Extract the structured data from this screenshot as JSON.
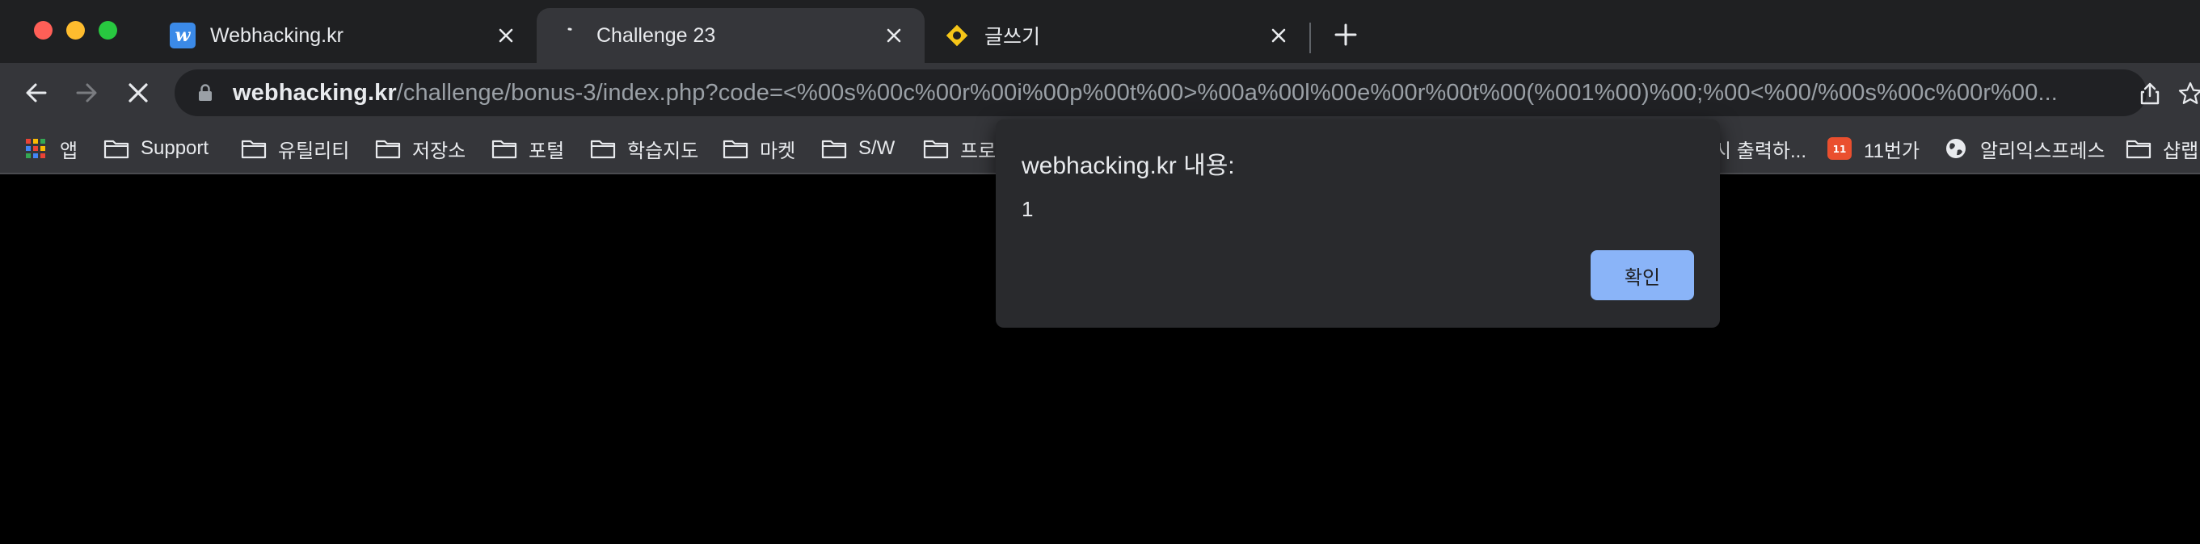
{
  "tabs": [
    {
      "title": "Webhacking.kr",
      "favicon_letter": "w",
      "active": false
    },
    {
      "title": "Challenge 23",
      "active": true
    },
    {
      "title": "글쓰기",
      "active": false
    }
  ],
  "address_bar": {
    "url_host": "webhacking.kr",
    "url_rest": "/challenge/bonus-3/index.php?code=<%00s%00c%00r%00i%00p%00t%00>%00a%00l%00e%00r%00t%00(%001%00)%00;%00<%00/%00s%00c%00r%00..."
  },
  "bookmarks": [
    {
      "label": "앱",
      "icon": "apps-grid-icon"
    },
    {
      "label": "Support",
      "icon": "folder-icon"
    },
    {
      "label": "유틸리티",
      "icon": "folder-icon"
    },
    {
      "label": "저장소",
      "icon": "folder-icon"
    },
    {
      "label": "포털",
      "icon": "folder-icon"
    },
    {
      "label": "학습지도",
      "icon": "folder-icon"
    },
    {
      "label": "마켓",
      "icon": "folder-icon"
    },
    {
      "label": "S/W",
      "icon": "folder-icon"
    },
    {
      "label": "프로",
      "icon": "folder-icon"
    },
    {
      "label": "시 출력하...",
      "icon": "page-icon"
    },
    {
      "label": "11번가",
      "icon": "11st-icon"
    },
    {
      "label": "알리익스프레스",
      "icon": "globe-icon"
    },
    {
      "label": "샵랩",
      "icon": "folder-icon"
    }
  ],
  "dialog": {
    "title": "webhacking.kr 내용:",
    "message": "1",
    "ok_label": "확인"
  },
  "colors": {
    "tab_strip": "#1f2022",
    "toolbar": "#35363a",
    "omnibox": "#202124",
    "dialog": "#292a2d",
    "ok_button": "#8ab4f8",
    "page_bg": "#000000"
  }
}
